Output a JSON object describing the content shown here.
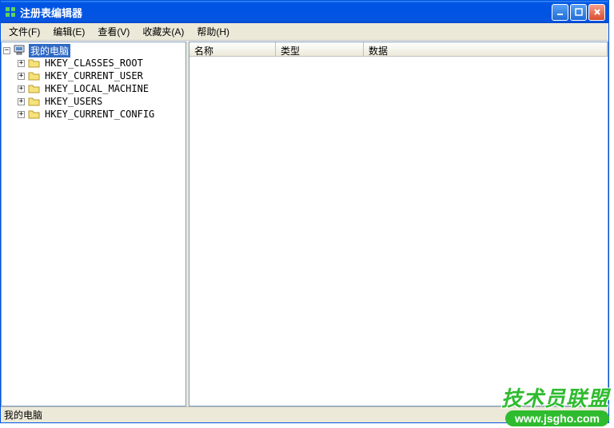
{
  "window": {
    "title": "注册表编辑器"
  },
  "menu": {
    "file": "文件(F)",
    "edit": "编辑(E)",
    "view": "查看(V)",
    "favorites": "收藏夹(A)",
    "help": "帮助(H)"
  },
  "tree": {
    "root": "我的电脑",
    "keys": [
      "HKEY_CLASSES_ROOT",
      "HKEY_CURRENT_USER",
      "HKEY_LOCAL_MACHINE",
      "HKEY_USERS",
      "HKEY_CURRENT_CONFIG"
    ]
  },
  "columns": {
    "name": "名称",
    "type": "类型",
    "data": "数据"
  },
  "statusbar": {
    "path": "我的电脑"
  },
  "watermark": {
    "title": "技术员联盟",
    "url": "www.jsgho.com"
  },
  "toggles": {
    "minus": "−",
    "plus": "+"
  }
}
